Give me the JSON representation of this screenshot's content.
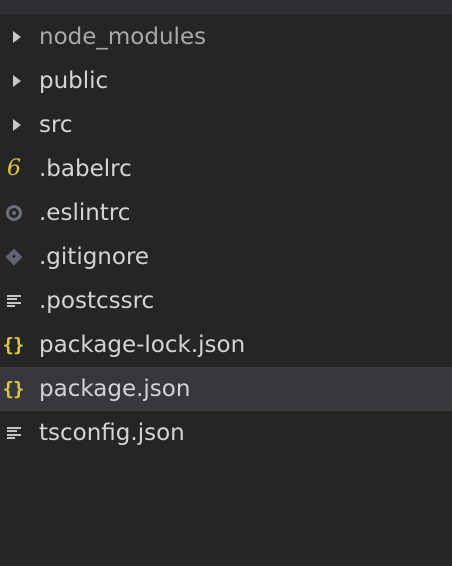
{
  "explorer": {
    "items": [
      {
        "label": "node_modules",
        "type": "folder",
        "icon": "chevron-right-icon"
      },
      {
        "label": "public",
        "type": "folder",
        "icon": "chevron-right-icon"
      },
      {
        "label": "src",
        "type": "folder",
        "icon": "chevron-right-icon"
      },
      {
        "label": ".babelrc",
        "type": "file",
        "icon": "babel-icon",
        "icon_glyph": "6"
      },
      {
        "label": ".eslintrc",
        "type": "file",
        "icon": "eslint-icon"
      },
      {
        "label": ".gitignore",
        "type": "file",
        "icon": "git-icon"
      },
      {
        "label": ".postcssrc",
        "type": "file",
        "icon": "text-file-icon"
      },
      {
        "label": "package-lock.json",
        "type": "file",
        "icon": "json-icon",
        "icon_glyph": "{}"
      },
      {
        "label": "package.json",
        "type": "file",
        "icon": "json-icon",
        "icon_glyph": "{}",
        "selected": true
      },
      {
        "label": "tsconfig.json",
        "type": "file",
        "icon": "text-file-icon"
      }
    ]
  },
  "colors": {
    "background": "#252526",
    "selected_row": "#37373d",
    "text": "#d4d4d4",
    "json_icon": "#d9c843",
    "babel_icon": "#d9c843"
  }
}
